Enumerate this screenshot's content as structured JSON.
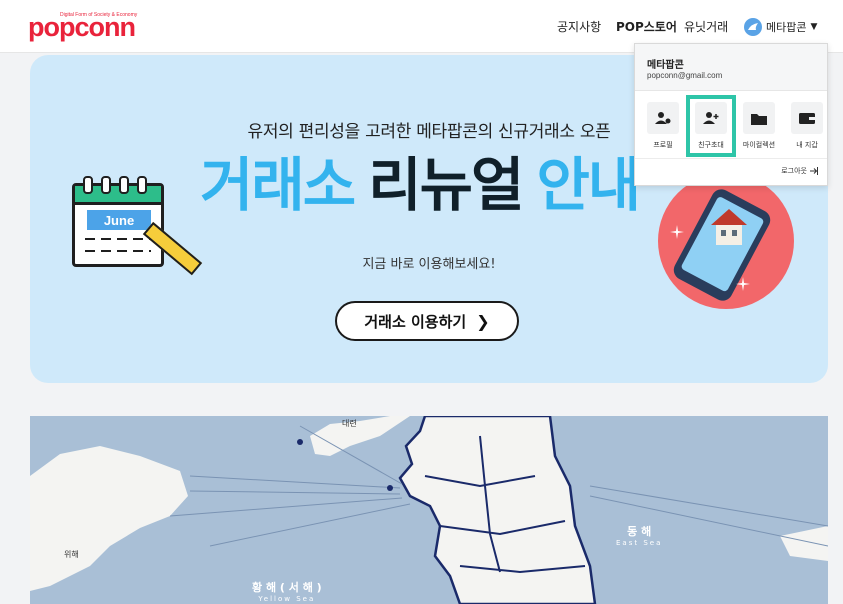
{
  "header": {
    "logo_text": "popconn",
    "logo_tagline": "Digital Form of Society & Economy",
    "nav": [
      "공지사항",
      "POP스토어",
      "유닛거래"
    ],
    "user_name": "메타팝콘"
  },
  "banner": {
    "subtitle": "유저의 편리성을 고려한 메타팝콘의 신규거래소 오픈",
    "headline_part1": "거래소",
    "headline_part2": "리뉴얼",
    "headline_part3": "안내",
    "note": "지금 바로 이용해보세요!",
    "cta_label": "거래소 이용하기",
    "calendar_label": "June"
  },
  "dropdown": {
    "name": "메타팝콘",
    "email": "popconn@gmail.com",
    "items": [
      {
        "label": "프로필",
        "icon": "profile-icon"
      },
      {
        "label": "친구초대",
        "icon": "add-friend-icon"
      },
      {
        "label": "마이컬렉션",
        "icon": "folder-icon"
      },
      {
        "label": "내 지갑",
        "icon": "wallet-icon"
      }
    ],
    "logout_label": "로그아웃"
  },
  "map": {
    "labels": {
      "east_sea": "동 해",
      "east_sea_en": "East Sea",
      "yellow_sea": "황 해 ( 서 해 )",
      "yellow_sea_en": "Yellow Sea",
      "weihai": "위해",
      "dalian": "대련"
    }
  },
  "colors": {
    "brand_red": "#e9233b",
    "banner_bg": "#cfe9fa",
    "headline_blue": "#33b3ee",
    "highlight_teal": "#2ec5a8",
    "map_sea": "#a9bfd6"
  }
}
